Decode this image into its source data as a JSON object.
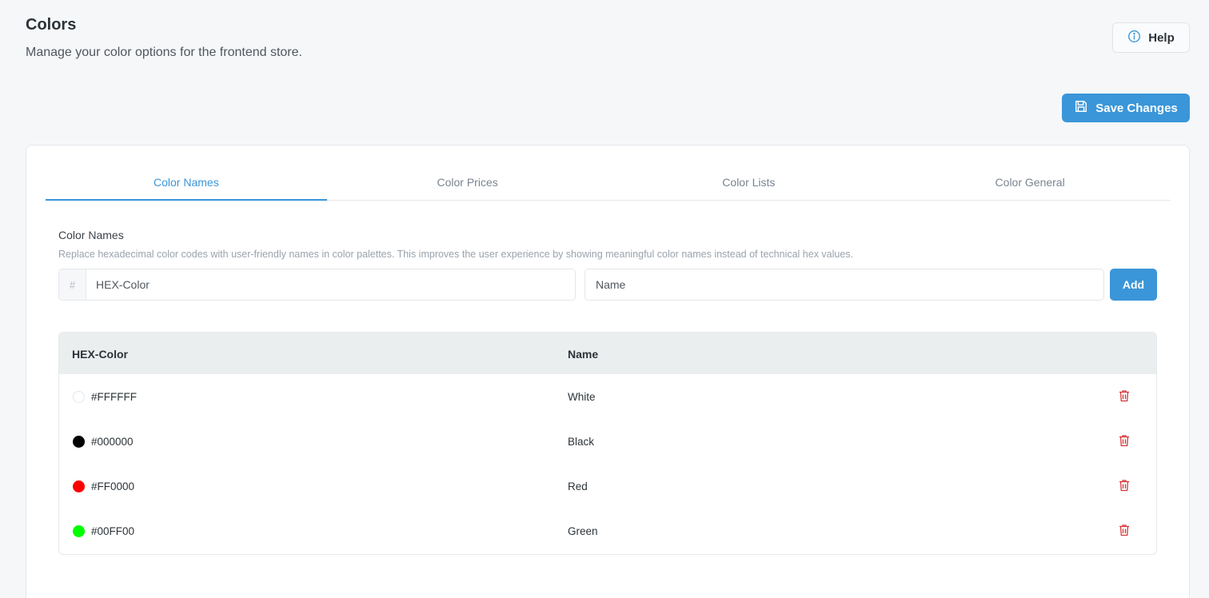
{
  "header": {
    "title": "Colors",
    "subtitle": "Manage your color options for the frontend store.",
    "help_label": "Help",
    "save_label": "Save Changes"
  },
  "tabs": [
    {
      "label": "Color Names",
      "active": true
    },
    {
      "label": "Color Prices",
      "active": false
    },
    {
      "label": "Color Lists",
      "active": false
    },
    {
      "label": "Color General",
      "active": false
    }
  ],
  "section": {
    "title": "Color Names",
    "description": "Replace hexadecimal color codes with user-friendly names in color palettes. This improves the user experience by showing meaningful color names instead of technical hex values."
  },
  "form": {
    "hex_prefix": "#",
    "hex_placeholder": "HEX-Color",
    "name_placeholder": "Name",
    "add_label": "Add"
  },
  "table": {
    "columns": [
      "HEX-Color",
      "Name"
    ],
    "rows": [
      {
        "hex": "#FFFFFF",
        "name": "White",
        "swatch": "#FFFFFF"
      },
      {
        "hex": "#000000",
        "name": "Black",
        "swatch": "#000000"
      },
      {
        "hex": "#FF0000",
        "name": "Red",
        "swatch": "#FF0000"
      },
      {
        "hex": "#00FF00",
        "name": "Green",
        "swatch": "#00FF00"
      }
    ]
  },
  "colors": {
    "accent": "#3a96d8",
    "delete": "#d63638"
  },
  "icons": {
    "help": "info-circle-icon",
    "save": "floppy-disk-icon",
    "delete": "trash-icon"
  }
}
